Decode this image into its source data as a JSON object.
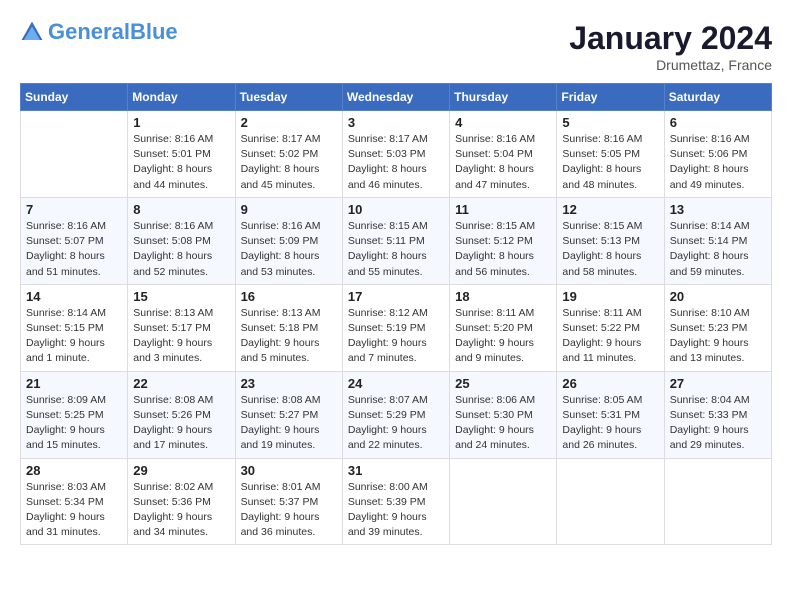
{
  "header": {
    "logo_general": "General",
    "logo_blue": "Blue",
    "month_title": "January 2024",
    "location": "Drumettaz, France"
  },
  "days_of_week": [
    "Sunday",
    "Monday",
    "Tuesday",
    "Wednesday",
    "Thursday",
    "Friday",
    "Saturday"
  ],
  "weeks": [
    [
      {
        "day": "",
        "sunrise": "",
        "sunset": "",
        "daylight": ""
      },
      {
        "day": "1",
        "sunrise": "Sunrise: 8:16 AM",
        "sunset": "Sunset: 5:01 PM",
        "daylight": "Daylight: 8 hours and 44 minutes."
      },
      {
        "day": "2",
        "sunrise": "Sunrise: 8:17 AM",
        "sunset": "Sunset: 5:02 PM",
        "daylight": "Daylight: 8 hours and 45 minutes."
      },
      {
        "day": "3",
        "sunrise": "Sunrise: 8:17 AM",
        "sunset": "Sunset: 5:03 PM",
        "daylight": "Daylight: 8 hours and 46 minutes."
      },
      {
        "day": "4",
        "sunrise": "Sunrise: 8:16 AM",
        "sunset": "Sunset: 5:04 PM",
        "daylight": "Daylight: 8 hours and 47 minutes."
      },
      {
        "day": "5",
        "sunrise": "Sunrise: 8:16 AM",
        "sunset": "Sunset: 5:05 PM",
        "daylight": "Daylight: 8 hours and 48 minutes."
      },
      {
        "day": "6",
        "sunrise": "Sunrise: 8:16 AM",
        "sunset": "Sunset: 5:06 PM",
        "daylight": "Daylight: 8 hours and 49 minutes."
      }
    ],
    [
      {
        "day": "7",
        "sunrise": "Sunrise: 8:16 AM",
        "sunset": "Sunset: 5:07 PM",
        "daylight": "Daylight: 8 hours and 51 minutes."
      },
      {
        "day": "8",
        "sunrise": "Sunrise: 8:16 AM",
        "sunset": "Sunset: 5:08 PM",
        "daylight": "Daylight: 8 hours and 52 minutes."
      },
      {
        "day": "9",
        "sunrise": "Sunrise: 8:16 AM",
        "sunset": "Sunset: 5:09 PM",
        "daylight": "Daylight: 8 hours and 53 minutes."
      },
      {
        "day": "10",
        "sunrise": "Sunrise: 8:15 AM",
        "sunset": "Sunset: 5:11 PM",
        "daylight": "Daylight: 8 hours and 55 minutes."
      },
      {
        "day": "11",
        "sunrise": "Sunrise: 8:15 AM",
        "sunset": "Sunset: 5:12 PM",
        "daylight": "Daylight: 8 hours and 56 minutes."
      },
      {
        "day": "12",
        "sunrise": "Sunrise: 8:15 AM",
        "sunset": "Sunset: 5:13 PM",
        "daylight": "Daylight: 8 hours and 58 minutes."
      },
      {
        "day": "13",
        "sunrise": "Sunrise: 8:14 AM",
        "sunset": "Sunset: 5:14 PM",
        "daylight": "Daylight: 8 hours and 59 minutes."
      }
    ],
    [
      {
        "day": "14",
        "sunrise": "Sunrise: 8:14 AM",
        "sunset": "Sunset: 5:15 PM",
        "daylight": "Daylight: 9 hours and 1 minute."
      },
      {
        "day": "15",
        "sunrise": "Sunrise: 8:13 AM",
        "sunset": "Sunset: 5:17 PM",
        "daylight": "Daylight: 9 hours and 3 minutes."
      },
      {
        "day": "16",
        "sunrise": "Sunrise: 8:13 AM",
        "sunset": "Sunset: 5:18 PM",
        "daylight": "Daylight: 9 hours and 5 minutes."
      },
      {
        "day": "17",
        "sunrise": "Sunrise: 8:12 AM",
        "sunset": "Sunset: 5:19 PM",
        "daylight": "Daylight: 9 hours and 7 minutes."
      },
      {
        "day": "18",
        "sunrise": "Sunrise: 8:11 AM",
        "sunset": "Sunset: 5:20 PM",
        "daylight": "Daylight: 9 hours and 9 minutes."
      },
      {
        "day": "19",
        "sunrise": "Sunrise: 8:11 AM",
        "sunset": "Sunset: 5:22 PM",
        "daylight": "Daylight: 9 hours and 11 minutes."
      },
      {
        "day": "20",
        "sunrise": "Sunrise: 8:10 AM",
        "sunset": "Sunset: 5:23 PM",
        "daylight": "Daylight: 9 hours and 13 minutes."
      }
    ],
    [
      {
        "day": "21",
        "sunrise": "Sunrise: 8:09 AM",
        "sunset": "Sunset: 5:25 PM",
        "daylight": "Daylight: 9 hours and 15 minutes."
      },
      {
        "day": "22",
        "sunrise": "Sunrise: 8:08 AM",
        "sunset": "Sunset: 5:26 PM",
        "daylight": "Daylight: 9 hours and 17 minutes."
      },
      {
        "day": "23",
        "sunrise": "Sunrise: 8:08 AM",
        "sunset": "Sunset: 5:27 PM",
        "daylight": "Daylight: 9 hours and 19 minutes."
      },
      {
        "day": "24",
        "sunrise": "Sunrise: 8:07 AM",
        "sunset": "Sunset: 5:29 PM",
        "daylight": "Daylight: 9 hours and 22 minutes."
      },
      {
        "day": "25",
        "sunrise": "Sunrise: 8:06 AM",
        "sunset": "Sunset: 5:30 PM",
        "daylight": "Daylight: 9 hours and 24 minutes."
      },
      {
        "day": "26",
        "sunrise": "Sunrise: 8:05 AM",
        "sunset": "Sunset: 5:31 PM",
        "daylight": "Daylight: 9 hours and 26 minutes."
      },
      {
        "day": "27",
        "sunrise": "Sunrise: 8:04 AM",
        "sunset": "Sunset: 5:33 PM",
        "daylight": "Daylight: 9 hours and 29 minutes."
      }
    ],
    [
      {
        "day": "28",
        "sunrise": "Sunrise: 8:03 AM",
        "sunset": "Sunset: 5:34 PM",
        "daylight": "Daylight: 9 hours and 31 minutes."
      },
      {
        "day": "29",
        "sunrise": "Sunrise: 8:02 AM",
        "sunset": "Sunset: 5:36 PM",
        "daylight": "Daylight: 9 hours and 34 minutes."
      },
      {
        "day": "30",
        "sunrise": "Sunrise: 8:01 AM",
        "sunset": "Sunset: 5:37 PM",
        "daylight": "Daylight: 9 hours and 36 minutes."
      },
      {
        "day": "31",
        "sunrise": "Sunrise: 8:00 AM",
        "sunset": "Sunset: 5:39 PM",
        "daylight": "Daylight: 9 hours and 39 minutes."
      },
      {
        "day": "",
        "sunrise": "",
        "sunset": "",
        "daylight": ""
      },
      {
        "day": "",
        "sunrise": "",
        "sunset": "",
        "daylight": ""
      },
      {
        "day": "",
        "sunrise": "",
        "sunset": "",
        "daylight": ""
      }
    ]
  ]
}
